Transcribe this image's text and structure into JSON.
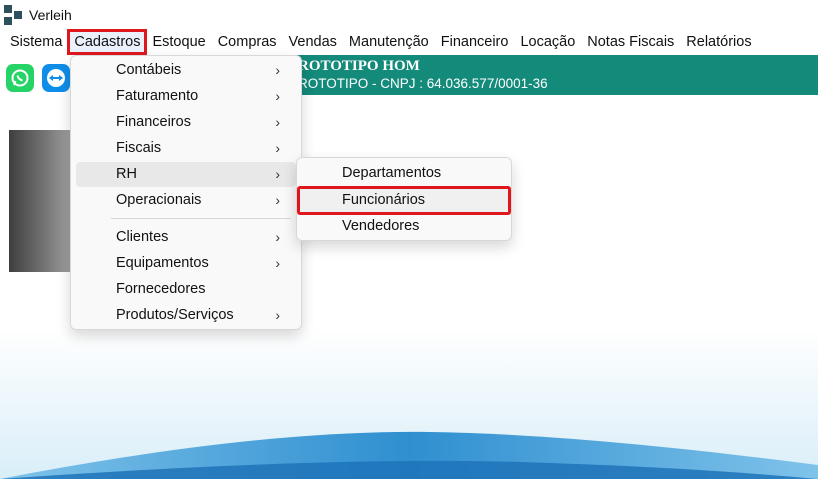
{
  "window": {
    "title": "Verleih"
  },
  "menubar": {
    "items": [
      "Sistema",
      "Cadastros",
      "Estoque",
      "Compras",
      "Vendas",
      "Manutenção",
      "Financeiro",
      "Locação",
      "Notas Fiscais",
      "Relatórios"
    ],
    "active": "Cadastros"
  },
  "banner": {
    "line1": "ROTOTIPO HOM",
    "line2": "ROTOTIPO - CNPJ : 64.036.577/0001-36",
    "color": "#138a7a"
  },
  "toolbar": {
    "icons": [
      "whatsapp-icon",
      "teamviewer-icon"
    ]
  },
  "cadastros_menu": {
    "items": [
      {
        "label": "Contábeis",
        "has_submenu": true
      },
      {
        "label": "Faturamento",
        "has_submenu": true
      },
      {
        "label": "Financeiros",
        "has_submenu": true
      },
      {
        "label": "Fiscais",
        "has_submenu": true
      },
      {
        "label": "RH",
        "has_submenu": true
      },
      {
        "label": "Operacionais",
        "has_submenu": true
      },
      {
        "label": "Clientes",
        "has_submenu": true
      },
      {
        "label": "Equipamentos",
        "has_submenu": true
      },
      {
        "label": "Fornecedores",
        "has_submenu": false
      },
      {
        "label": "Produtos/Serviços",
        "has_submenu": true
      }
    ],
    "hovered": "RH"
  },
  "rh_submenu": {
    "items": [
      "Departamentos",
      "Funcionários",
      "Vendedores"
    ],
    "highlighted": "Funcionários"
  },
  "colors": {
    "highlight_box": "#e0161d",
    "banner": "#138a7a"
  }
}
